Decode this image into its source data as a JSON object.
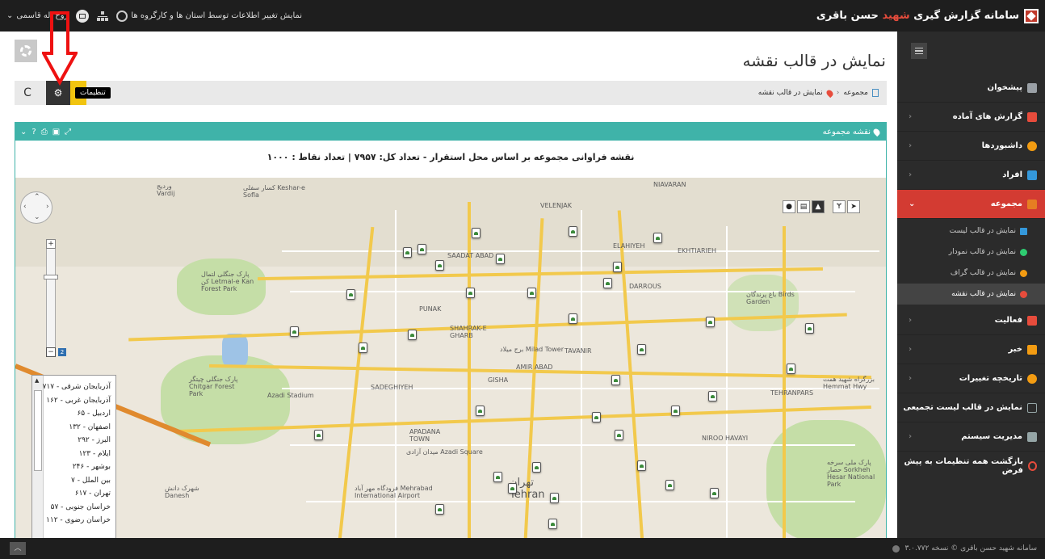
{
  "topbar": {
    "brand_prefix": "سامانه گزارش گیری",
    "brand_red": "شهید",
    "brand_suffix": "حسن باقری",
    "user_name": "روح اله قاسمی",
    "notification": "نمایش تغییر اطلاعات توسط استان ها و کارگروه ها"
  },
  "page": {
    "title": "نمایش در قالب نقشه"
  },
  "breadcrumb": {
    "root": "مجموعه",
    "current": "نمایش در قالب نقشه"
  },
  "toolbar": {
    "tooltip": "تنظیمات",
    "refresh": "C"
  },
  "panel": {
    "title": "نقشه مجموعه",
    "map_title": "نقشه فراوانی مجموعه بر اساس محل استقرار - تعداد کل: ۷۹۵۷ | تعداد نقاط : ۱۰۰۰"
  },
  "map": {
    "labels": {
      "milad": "برج میلاد Milad Tower",
      "azadi_stadium": "Azadi Stadium",
      "azadi_square": "میدان آزادی Azadi Square",
      "chitgar": "پارک جنگلی چیتگر Chitgar Forest Park",
      "letmal": "پارک جنگلی لتمال کن Letmal-e Kan Forest Park",
      "airport": "فرودگاه مهر آباد Mehrabad International Airport",
      "tehran": "تهران Tehran",
      "birds": "باغ پرندگان Birds Garden",
      "sorkheh": "پارک ملی سرخه حصار Sorkheh Hesar National Park",
      "keshar": "کسار سفلی Keshar-e Sofla",
      "vardij": "وردیج Vardij",
      "hemmat": "بزرگراه شهید همت Hemmat Hwy",
      "elahiyeh": "ELAHIYEH",
      "darrous": "DARROUS",
      "niavaran": "NIAVARAN",
      "velenjak": "VELENJAK",
      "saadat": "SAADAT ABAD",
      "punak": "PUNAK",
      "sharak_gharb": "SHAHRAK-E GHARB",
      "tavanir": "TAVANIR",
      "amir_abad": "AMIR ABAD",
      "gisha": "GISHA",
      "sadeghiyeh": "SADEGHIYEH",
      "ekhtiarieh": "EKHTIARIEH",
      "tehranpars": "TEHRANPARS",
      "niroo_havayi": "NIROO HAVAYI",
      "apadana": "APADANA TOWN",
      "danesh": "شهرک دانش Danesh"
    },
    "legend": [
      "آذربایجان شرقی - ۷۱۷",
      "آذربایجان غربی - ۱۶۲",
      "اردبیل - ۶۵",
      "اصفهان - ۱۳۲",
      "البرز - ۲۹۲",
      "ایلام - ۱۲۳",
      "بوشهر - ۲۴۶",
      "بین الملل - ۷",
      "تهران - ۶۱۷",
      "خراسان جنوبی - ۵۷",
      "خراسان رضوی - ۱۱۲"
    ],
    "zoom_level": "2"
  },
  "sidebar": {
    "items": [
      {
        "label": "پیشخوان",
        "icon": "home-icon",
        "color": "#9aa0a6",
        "chevron": false
      },
      {
        "label": "گزارش های آماده",
        "icon": "chart-icon",
        "color": "#e74c3c",
        "chevron": true
      },
      {
        "label": "داشبوردها",
        "icon": "dashboard-icon",
        "color": "#f39c12",
        "chevron": true
      },
      {
        "label": "افراد",
        "icon": "users-icon",
        "color": "#3498db",
        "chevron": true
      },
      {
        "label": "مجموعه",
        "icon": "building-icon",
        "color": "#e67e22",
        "chevron": true,
        "active": true
      }
    ],
    "subitems": [
      {
        "label": "نمایش در قالب لیست",
        "color": "#3498db"
      },
      {
        "label": "نمایش در قالب نمودار",
        "color": "#2ecc71"
      },
      {
        "label": "نمایش در قالب گراف",
        "color": "#f39c12"
      },
      {
        "label": "نمایش در قالب نقشه",
        "color": "#e74c3c",
        "active": true
      }
    ],
    "items2": [
      {
        "label": "فعالیت",
        "icon": "activity-icon",
        "color": "#e74c3c",
        "chevron": true
      },
      {
        "label": "خبر",
        "icon": "megaphone-icon",
        "color": "#f39c12",
        "chevron": true
      },
      {
        "label": "تاریخچه تغییرات",
        "icon": "history-icon",
        "color": "#f39c12",
        "chevron": true
      },
      {
        "label": "نمایش در قالب لیست تجمیعی",
        "icon": "list-icon",
        "color": "#95a5a6",
        "chevron": false
      },
      {
        "label": "مدیریت سیستم",
        "icon": "admin-icon",
        "color": "#95a5a6",
        "chevron": true
      },
      {
        "label": "بازگشت همه تنظیمات به پیش فرض",
        "icon": "reset-icon",
        "color": "#e74c3c",
        "chevron": false
      }
    ]
  },
  "footer": {
    "text": "سامانه شهید حسن باقری © نسخه ۳.۰.۷۷۲"
  },
  "colors": {
    "accent": "#3fb3a9",
    "active_menu": "#d33b32",
    "topbar": "#1e1e1e",
    "sidebar": "#2b2b2b"
  }
}
